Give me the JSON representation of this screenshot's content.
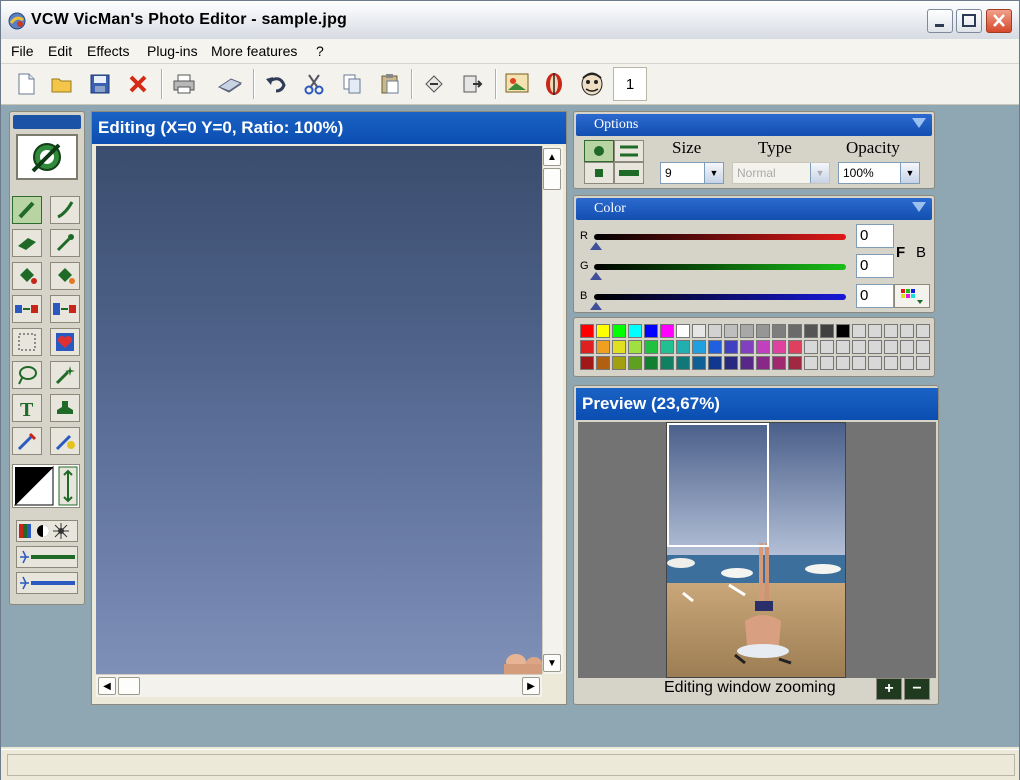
{
  "window": {
    "title": "VCW VicMan's Photo Editor - sample.jpg"
  },
  "menu": {
    "items": [
      "File",
      "Edit",
      "Effects",
      "Plug-ins",
      "More features",
      "?"
    ]
  },
  "toolbar": {
    "buttons": [
      "new-icon",
      "open-icon",
      "save-icon",
      "delete-icon",
      "print-icon",
      "scan-icon",
      "undo-icon",
      "cut-icon",
      "copy-icon",
      "paste-icon",
      "export-icon",
      "import-icon",
      "image-gallery-icon",
      "face-icon",
      "caricature-icon"
    ],
    "page_number": "1"
  },
  "editing": {
    "title": "Editing (X=0 Y=0, Ratio: 100%)"
  },
  "options": {
    "title": "Options",
    "size_label": "Size",
    "type_label": "Type",
    "opacity_label": "Opacity",
    "size_value": "9",
    "type_value": "Normal",
    "opacity_value": "100%"
  },
  "color": {
    "title": "Color",
    "r_label": "R",
    "g_label": "G",
    "b_label": "B",
    "r_value": "0",
    "g_value": "0",
    "b_value": "0",
    "f_label": "F",
    "b2_label": "B"
  },
  "palette": {
    "rows": [
      [
        "#ff0000",
        "#ffff00",
        "#00ff00",
        "#00ffff",
        "#0000ff",
        "#ff00ff",
        "#ffffff",
        "#e6e6e6",
        "#d2d2d2",
        "#bebebe",
        "#a8a8a8",
        "#969696",
        "#7e7e7e",
        "#6a6a6a",
        "#555555",
        "#404040",
        "#000000",
        "#d8d8d8",
        "#d8d8d8",
        "#d8d8d8",
        "#d8d8d8",
        "#d8d8d8"
      ],
      [
        "#e02020",
        "#f0a020",
        "#e0e020",
        "#a0e040",
        "#20c040",
        "#20c090",
        "#20b0b0",
        "#20a0e0",
        "#2060e0",
        "#4040c0",
        "#8040c0",
        "#c040c0",
        "#e040a0",
        "#e04060",
        "#d8d8d8",
        "#d8d8d8",
        "#d8d8d8",
        "#d8d8d8",
        "#d8d8d8",
        "#d8d8d8",
        "#d8d8d8",
        "#d8d8d8"
      ],
      [
        "#a01818",
        "#b06010",
        "#a0a010",
        "#60a020",
        "#108030",
        "#108060",
        "#107878",
        "#106098",
        "#103890",
        "#282880",
        "#582888",
        "#882888",
        "#a02870",
        "#a02840",
        "#d8d8d8",
        "#d8d8d8",
        "#d8d8d8",
        "#d8d8d8",
        "#d8d8d8",
        "#d8d8d8",
        "#d8d8d8",
        "#d8d8d8"
      ]
    ]
  },
  "preview": {
    "title": "Preview (23,67%)",
    "footer_label": "Editing window zooming",
    "zoom_in": "+",
    "zoom_out": "−"
  },
  "colors": {
    "titlebar_blue": "#0b4db0",
    "workspace": "#8ea7b3"
  }
}
